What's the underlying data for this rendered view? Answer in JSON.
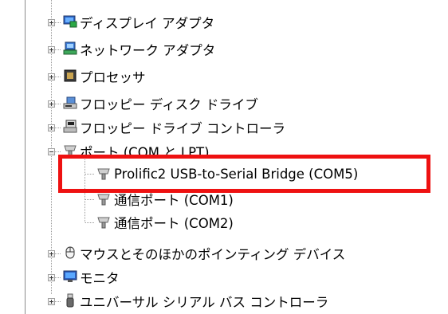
{
  "tree": {
    "items": [
      {
        "label": "ディスプレイ アダプタ",
        "icon": "display-adapter-icon",
        "expander": "plus"
      },
      {
        "label": "ネットワーク アダプタ",
        "icon": "network-adapter-icon",
        "expander": "plus"
      },
      {
        "label": "プロセッサ",
        "icon": "processor-icon",
        "expander": "plus"
      },
      {
        "label": "フロッピー ディスク ドライブ",
        "icon": "floppy-disk-drive-icon",
        "expander": "plus"
      },
      {
        "label": "フロッピー ドライブ コントローラ",
        "icon": "floppy-controller-icon",
        "expander": "plus"
      },
      {
        "label": "ポート (COM と LPT)",
        "icon": "port-icon",
        "expander": "minus"
      },
      {
        "label": "Prolific2 USB-to-Serial Bridge (COM5)",
        "icon": "port-icon",
        "child": true
      },
      {
        "label": "通信ポート (COM1)",
        "icon": "port-icon",
        "child": true
      },
      {
        "label": "通信ポート (COM2)",
        "icon": "port-icon",
        "child": true
      },
      {
        "label": "マウスとそのほかのポインティング デバイス",
        "icon": "mouse-icon",
        "expander": "plus"
      },
      {
        "label": "モニタ",
        "icon": "monitor-icon",
        "expander": "plus"
      },
      {
        "label": "ユニバーサル シリアル バス コントローラ",
        "icon": "usb-icon",
        "expander": "plus"
      }
    ]
  },
  "highlight": {
    "color": "#ee1111"
  }
}
